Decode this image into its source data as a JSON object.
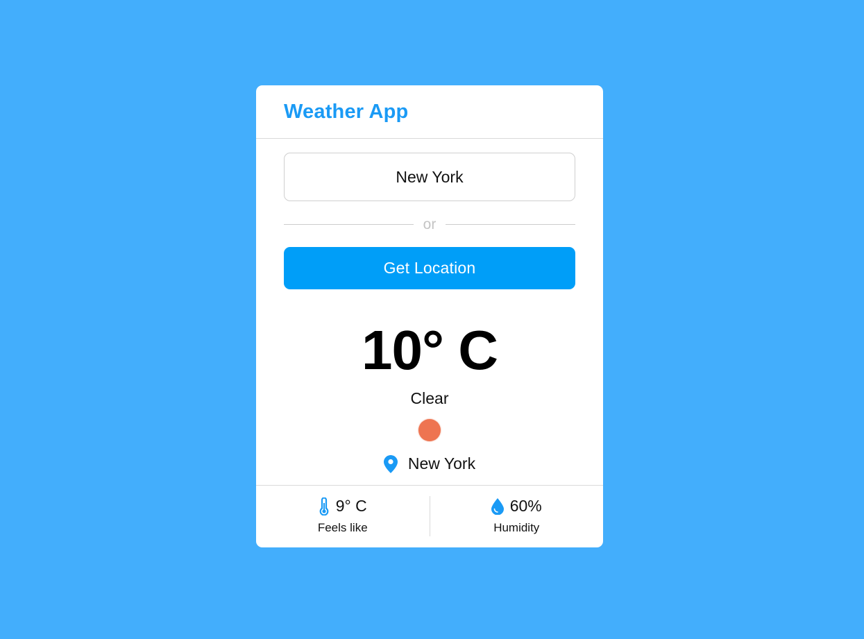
{
  "app": {
    "title": "Weather App"
  },
  "search": {
    "value": "New York",
    "separator": "or",
    "location_button": "Get Location"
  },
  "weather": {
    "temperature": "10° C",
    "description": "Clear",
    "condition_icon": "sun-icon",
    "location": "New York"
  },
  "details": {
    "feels_like_value": "9° C",
    "feels_like_label": "Feels like",
    "humidity_value": "60%",
    "humidity_label": "Humidity"
  },
  "colors": {
    "background": "#43aefc",
    "accent": "#009ef8",
    "title": "#1a9af5",
    "sun": "#ee7451"
  }
}
